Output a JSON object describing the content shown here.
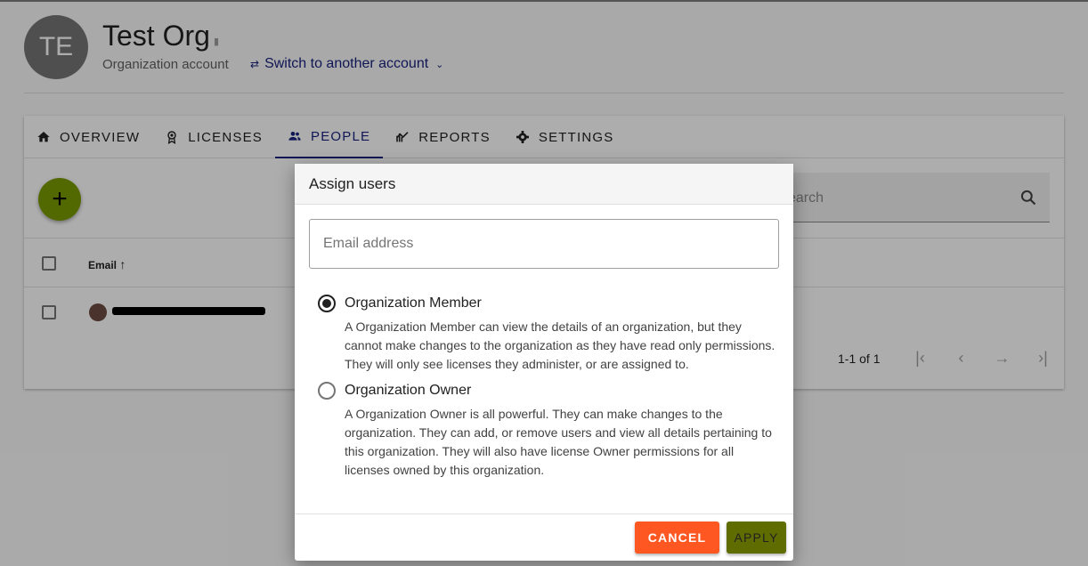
{
  "header": {
    "avatar_initials": "TE",
    "org_name": "Test Org",
    "account_type": "Organization account",
    "switch_label": "Switch to another account"
  },
  "tabs": [
    {
      "label": "OVERVIEW",
      "icon": "home-icon"
    },
    {
      "label": "LICENSES",
      "icon": "badge-icon"
    },
    {
      "label": "PEOPLE",
      "icon": "people-icon",
      "active": true
    },
    {
      "label": "REPORTS",
      "icon": "chart-icon"
    },
    {
      "label": "SETTINGS",
      "icon": "gear-icon"
    }
  ],
  "toolbar": {
    "add_label": "+",
    "search_placeholder": "earch"
  },
  "table": {
    "columns": [
      "Email"
    ],
    "sort_indicator": "↑"
  },
  "pagination": {
    "range": "1-1 of 1"
  },
  "dialog": {
    "title": "Assign users",
    "email_placeholder": "Email address",
    "options": [
      {
        "label": "Organization Member",
        "selected": true,
        "description": "A Organization Member can view the details of an organization, but they cannot make changes to the organization as they have read only permissions. They will only see licenses they administer, or are assigned to."
      },
      {
        "label": "Organization Owner",
        "selected": false,
        "description": "A Organization Owner is all powerful. They can make changes to the organization. They can add, or remove users and view all details pertaining to this organization. They will also have license Owner permissions for all licenses owned by this organization."
      }
    ],
    "cancel_label": "CANCEL",
    "apply_label": "APPLY"
  },
  "colors": {
    "accent": "#1a237e",
    "fab": "#7a9a01",
    "cancel": "#ff5722",
    "apply": "#5f6c00"
  }
}
